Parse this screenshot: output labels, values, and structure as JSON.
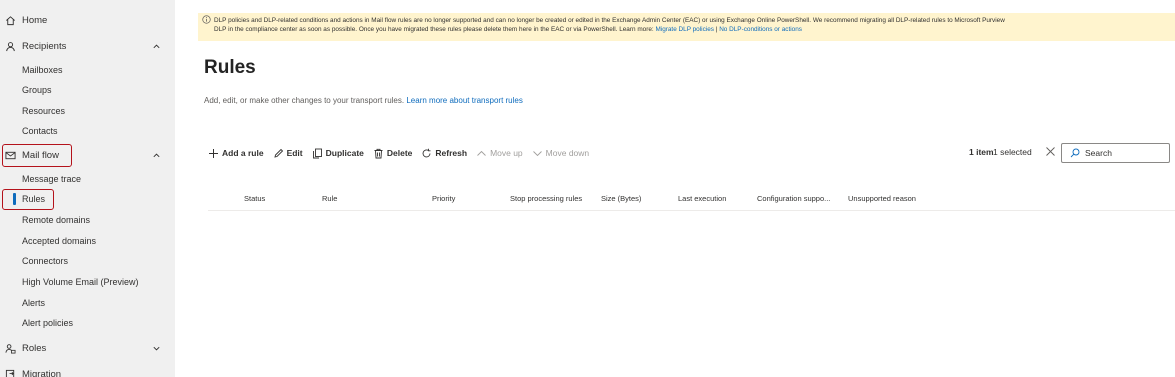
{
  "sidebar": {
    "items": [
      {
        "label": "Home",
        "icon": "home-icon"
      },
      {
        "label": "Recipients",
        "icon": "person-icon",
        "expanded": true
      },
      {
        "label": "Mailboxes"
      },
      {
        "label": "Groups"
      },
      {
        "label": "Resources"
      },
      {
        "label": "Contacts"
      },
      {
        "label": "Mail flow",
        "icon": "mail-icon",
        "expanded": true
      },
      {
        "label": "Message trace"
      },
      {
        "label": "Rules",
        "selected": true
      },
      {
        "label": "Remote domains"
      },
      {
        "label": "Accepted domains"
      },
      {
        "label": "Connectors"
      },
      {
        "label": "High Volume Email (Preview)"
      },
      {
        "label": "Alerts"
      },
      {
        "label": "Alert policies"
      },
      {
        "label": "Roles",
        "icon": "roles-icon",
        "expanded": false
      },
      {
        "label": "Migration",
        "icon": "migration-icon"
      }
    ]
  },
  "banner": {
    "line1": "DLP policies and DLP-related conditions and actions in Mail flow rules are no longer supported and can no longer be created or edited in the Exchange Admin Center (EAC) or using Exchange Online PowerShell. We recommend migrating all DLP-related rules to Microsoft Purview",
    "line2_prefix": "DLP in the compliance center as soon as possible. Once you have migrated these rules please delete them here in the EAC or via PowerShell. Learn more:",
    "link1": "Migrate DLP policies",
    "separator": "|",
    "link2": "No DLP-conditions or actions"
  },
  "page": {
    "title": "Rules",
    "description": "Add, edit, or make other changes to your transport rules.",
    "description_link": "Learn more about transport rules"
  },
  "toolbar": {
    "add": "Add a rule",
    "edit": "Edit",
    "duplicate": "Duplicate",
    "delete": "Delete",
    "refresh": "Refresh",
    "move_up": "Move up",
    "move_down": "Move down"
  },
  "status": {
    "items": "1 item",
    "selected": "1 selected"
  },
  "search": {
    "placeholder": "Search"
  },
  "table": {
    "columns": [
      "Status",
      "Rule",
      "Priority",
      "Stop processing rules",
      "Size (Bytes)",
      "Last execution",
      "Configuration suppo...",
      "Unsupported reason"
    ]
  },
  "colors": {
    "accent": "#0f6cbd",
    "banner_bg": "#fff4ce",
    "highlight": "#b4121b",
    "sidebar_bg": "#f0f0f0"
  }
}
